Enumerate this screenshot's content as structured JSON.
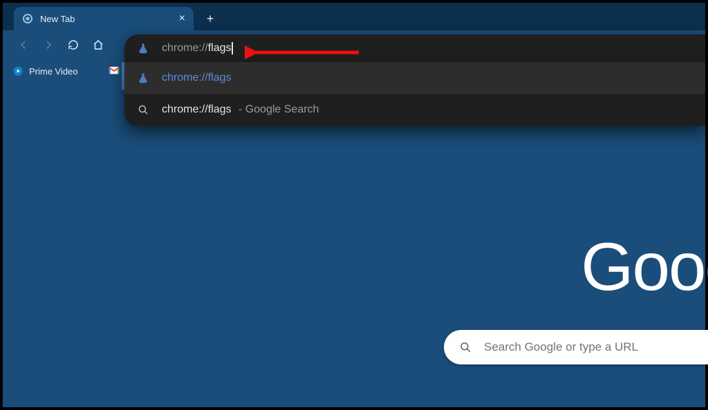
{
  "tab": {
    "title": "New Tab"
  },
  "omnibox": {
    "prefix": "chrome://",
    "rest": "flags"
  },
  "suggestions": [
    {
      "text": "chrome://flags",
      "type": "url",
      "active": true
    },
    {
      "text": "chrome://flags",
      "suffix": " - Google Search",
      "type": "search",
      "active": false
    }
  ],
  "bookmarks": {
    "prime": "Prime Video"
  },
  "content": {
    "logo": "Goog",
    "search_placeholder": "Search Google or type a URL"
  },
  "colors": {
    "bg": "#1a4d7a",
    "tabstrip": "#0c2f4d",
    "omnibox": "#1f1f1f"
  }
}
